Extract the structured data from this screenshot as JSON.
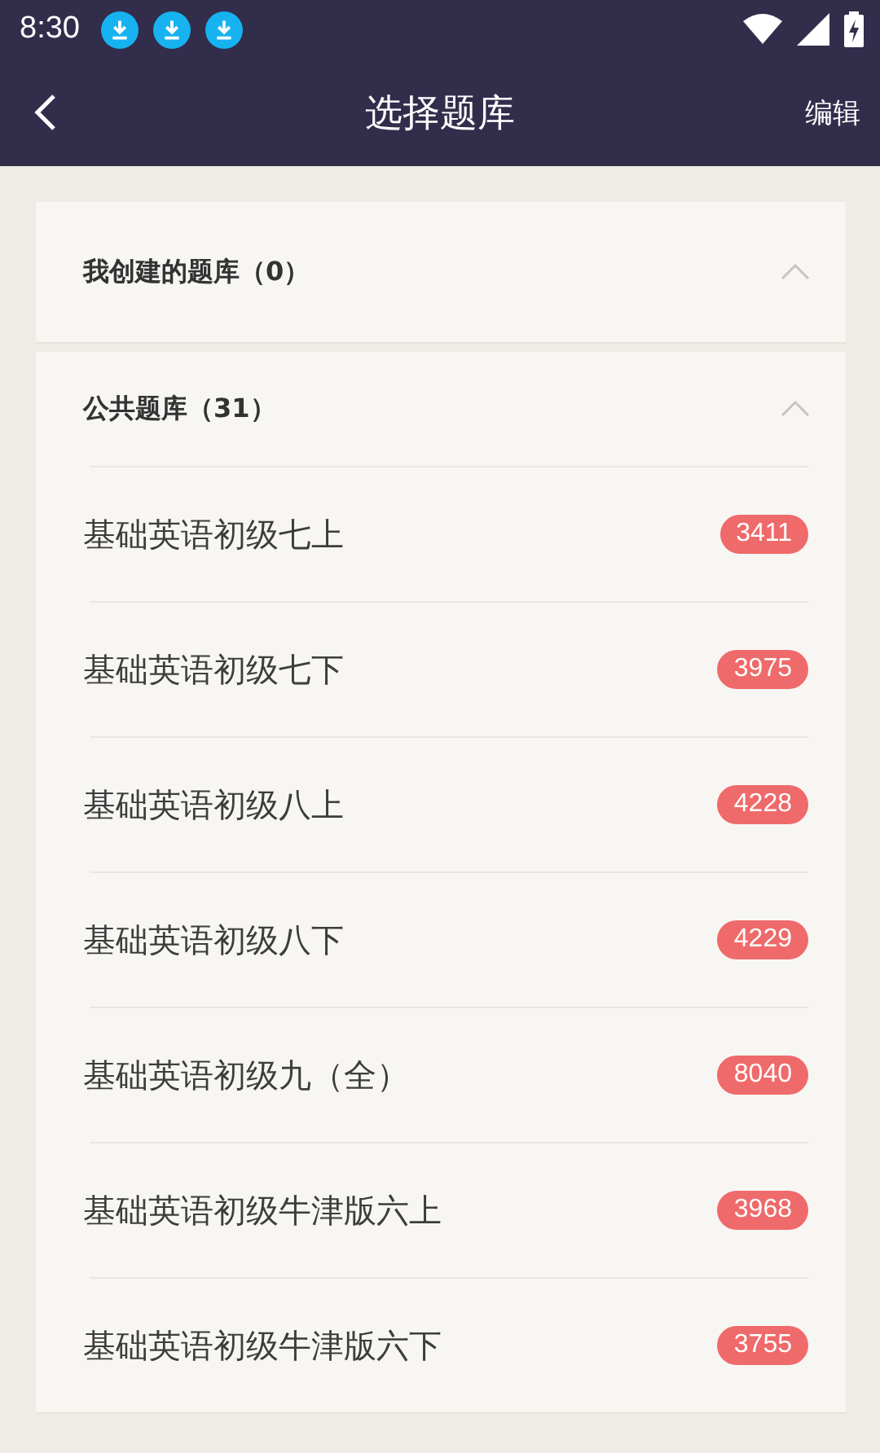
{
  "status_bar": {
    "time": "8:30",
    "notifications": [
      {
        "kind": "download"
      },
      {
        "kind": "download"
      },
      {
        "kind": "download"
      }
    ]
  },
  "app_bar": {
    "title": "选择题库",
    "action": "编辑"
  },
  "sections": [
    {
      "title": "我创建的题库（0）",
      "expanded": true
    },
    {
      "title": "公共题库（31）",
      "expanded": true,
      "items": [
        {
          "name": "基础英语初级七上",
          "count": "3411"
        },
        {
          "name": "基础英语初级七下",
          "count": "3975"
        },
        {
          "name": "基础英语初级八上",
          "count": "4228"
        },
        {
          "name": "基础英语初级八下",
          "count": "4229"
        },
        {
          "name": "基础英语初级九（全）",
          "count": "8040"
        },
        {
          "name": "基础英语初级牛津版六上",
          "count": "3968"
        },
        {
          "name": "基础英语初级牛津版六下",
          "count": "3755"
        }
      ]
    }
  ]
}
